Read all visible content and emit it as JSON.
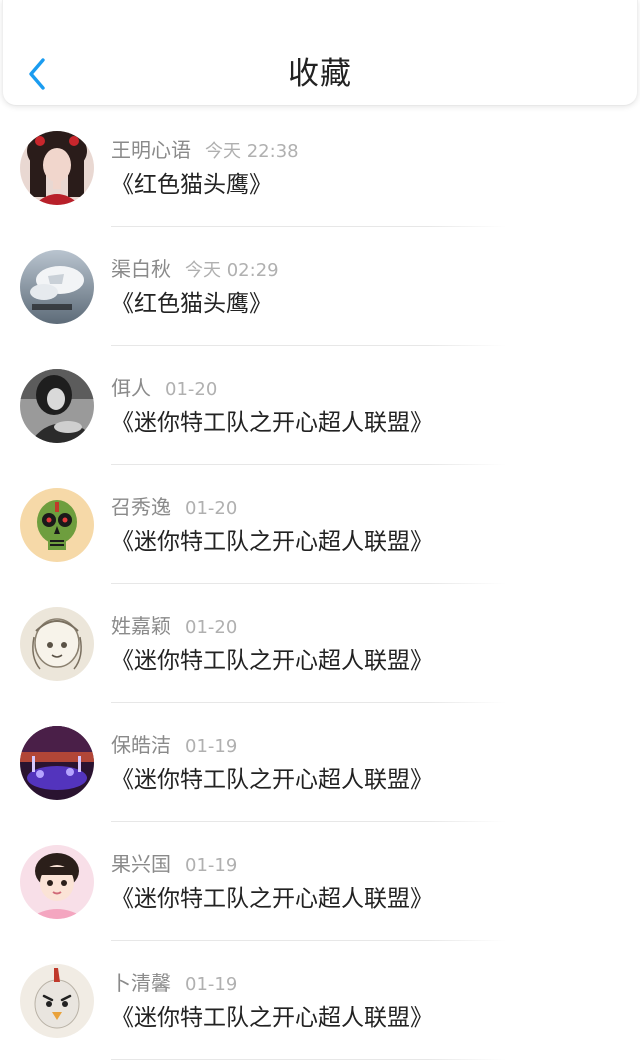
{
  "header": {
    "title": "收藏",
    "back_icon": "chevron-left-icon",
    "accent_color": "#1a9cf0"
  },
  "items": [
    {
      "name": "王明心语",
      "time": "今天 22:38",
      "work": "《红色猫头鹰》",
      "avatar_icon": "avatar-woman-portrait"
    },
    {
      "name": "渠白秋",
      "time": "今天 02:29",
      "work": "《红色猫头鹰》",
      "avatar_icon": "avatar-white-tiger"
    },
    {
      "name": "佴人",
      "time": "01-20",
      "work": "《迷你特工队之开心超人联盟》",
      "avatar_icon": "avatar-bw-girl"
    },
    {
      "name": "召秀逸",
      "time": "01-20",
      "work": "《迷你特工队之开心超人联盟》",
      "avatar_icon": "avatar-sugar-skull"
    },
    {
      "name": "姓嘉颖",
      "time": "01-20",
      "work": "《迷你特工队之开心超人联盟》",
      "avatar_icon": "avatar-sketch-anime"
    },
    {
      "name": "保皓洁",
      "time": "01-19",
      "work": "《迷你特工队之开心超人联盟》",
      "avatar_icon": "avatar-purple-lights"
    },
    {
      "name": "果兴国",
      "time": "01-19",
      "work": "《迷你特工队之开心超人联盟》",
      "avatar_icon": "avatar-little-girl"
    },
    {
      "name": "卜清馨",
      "time": "01-19",
      "work": "《迷你特工队之开心超人联盟》",
      "avatar_icon": "avatar-cartoon-bird"
    }
  ]
}
